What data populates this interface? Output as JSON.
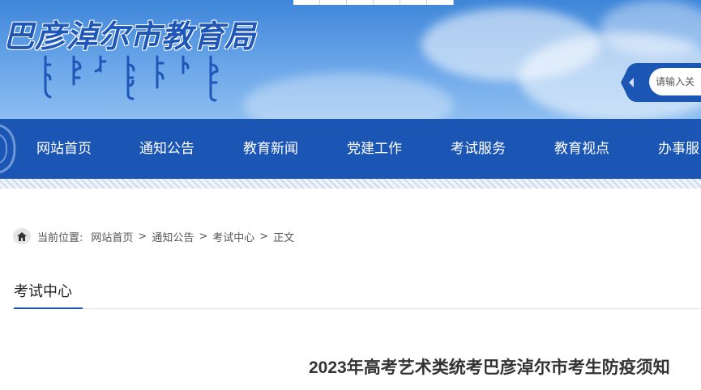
{
  "header": {
    "site_title": "巴彦淖尔市教育局",
    "search_placeholder": "请输入关",
    "accent_color": "#1c56b4"
  },
  "nav": {
    "items": [
      {
        "label": "网站首页"
      },
      {
        "label": "通知公告"
      },
      {
        "label": "教育新闻"
      },
      {
        "label": "党建工作"
      },
      {
        "label": "考试服务"
      },
      {
        "label": "教育视点"
      },
      {
        "label": "办事服"
      }
    ]
  },
  "breadcrumb": {
    "prefix": "当前位置:",
    "items": [
      "网站首页",
      "通知公告",
      "考试中心",
      "正文"
    ],
    "separator": ">"
  },
  "section": {
    "tab_label": "考试中心"
  },
  "article": {
    "title": "2023年高考艺术类统考巴彦淖尔市考生防疫须知"
  }
}
